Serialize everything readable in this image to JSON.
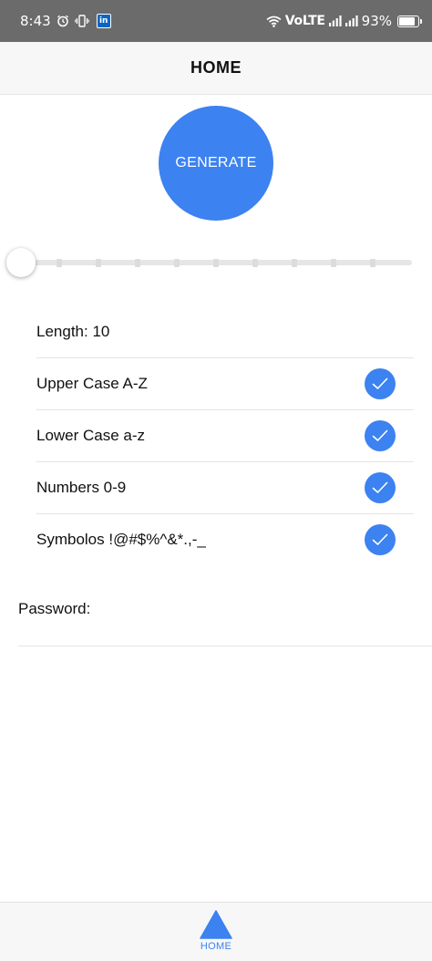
{
  "status_bar": {
    "time": "8:43",
    "linkedin_badge": "in",
    "network": "VoLTE",
    "battery": "93%",
    "battery_level": 0.93,
    "icons": [
      "alarm-icon",
      "vibrate-icon",
      "linkedin-icon",
      "wifi-icon",
      "signal-icon",
      "battery-icon"
    ]
  },
  "header": {
    "title": "HOME"
  },
  "generate_button": {
    "label": "GENERATE",
    "color": "#3c82f0"
  },
  "slider": {
    "value_fraction": 0.0,
    "steps": 11
  },
  "options": {
    "length_label": "Length: 10",
    "items": [
      {
        "label": "Upper Case A-Z",
        "checked": true
      },
      {
        "label": "Lower Case a-z",
        "checked": true
      },
      {
        "label": "Numbers 0-9",
        "checked": true
      },
      {
        "label": "Symbolos !@#$%^&*.,-_",
        "checked": true
      }
    ]
  },
  "password": {
    "label": "Password:",
    "value": ""
  },
  "tab_bar": {
    "home_label": "HOME",
    "accent": "#3c82f0"
  }
}
